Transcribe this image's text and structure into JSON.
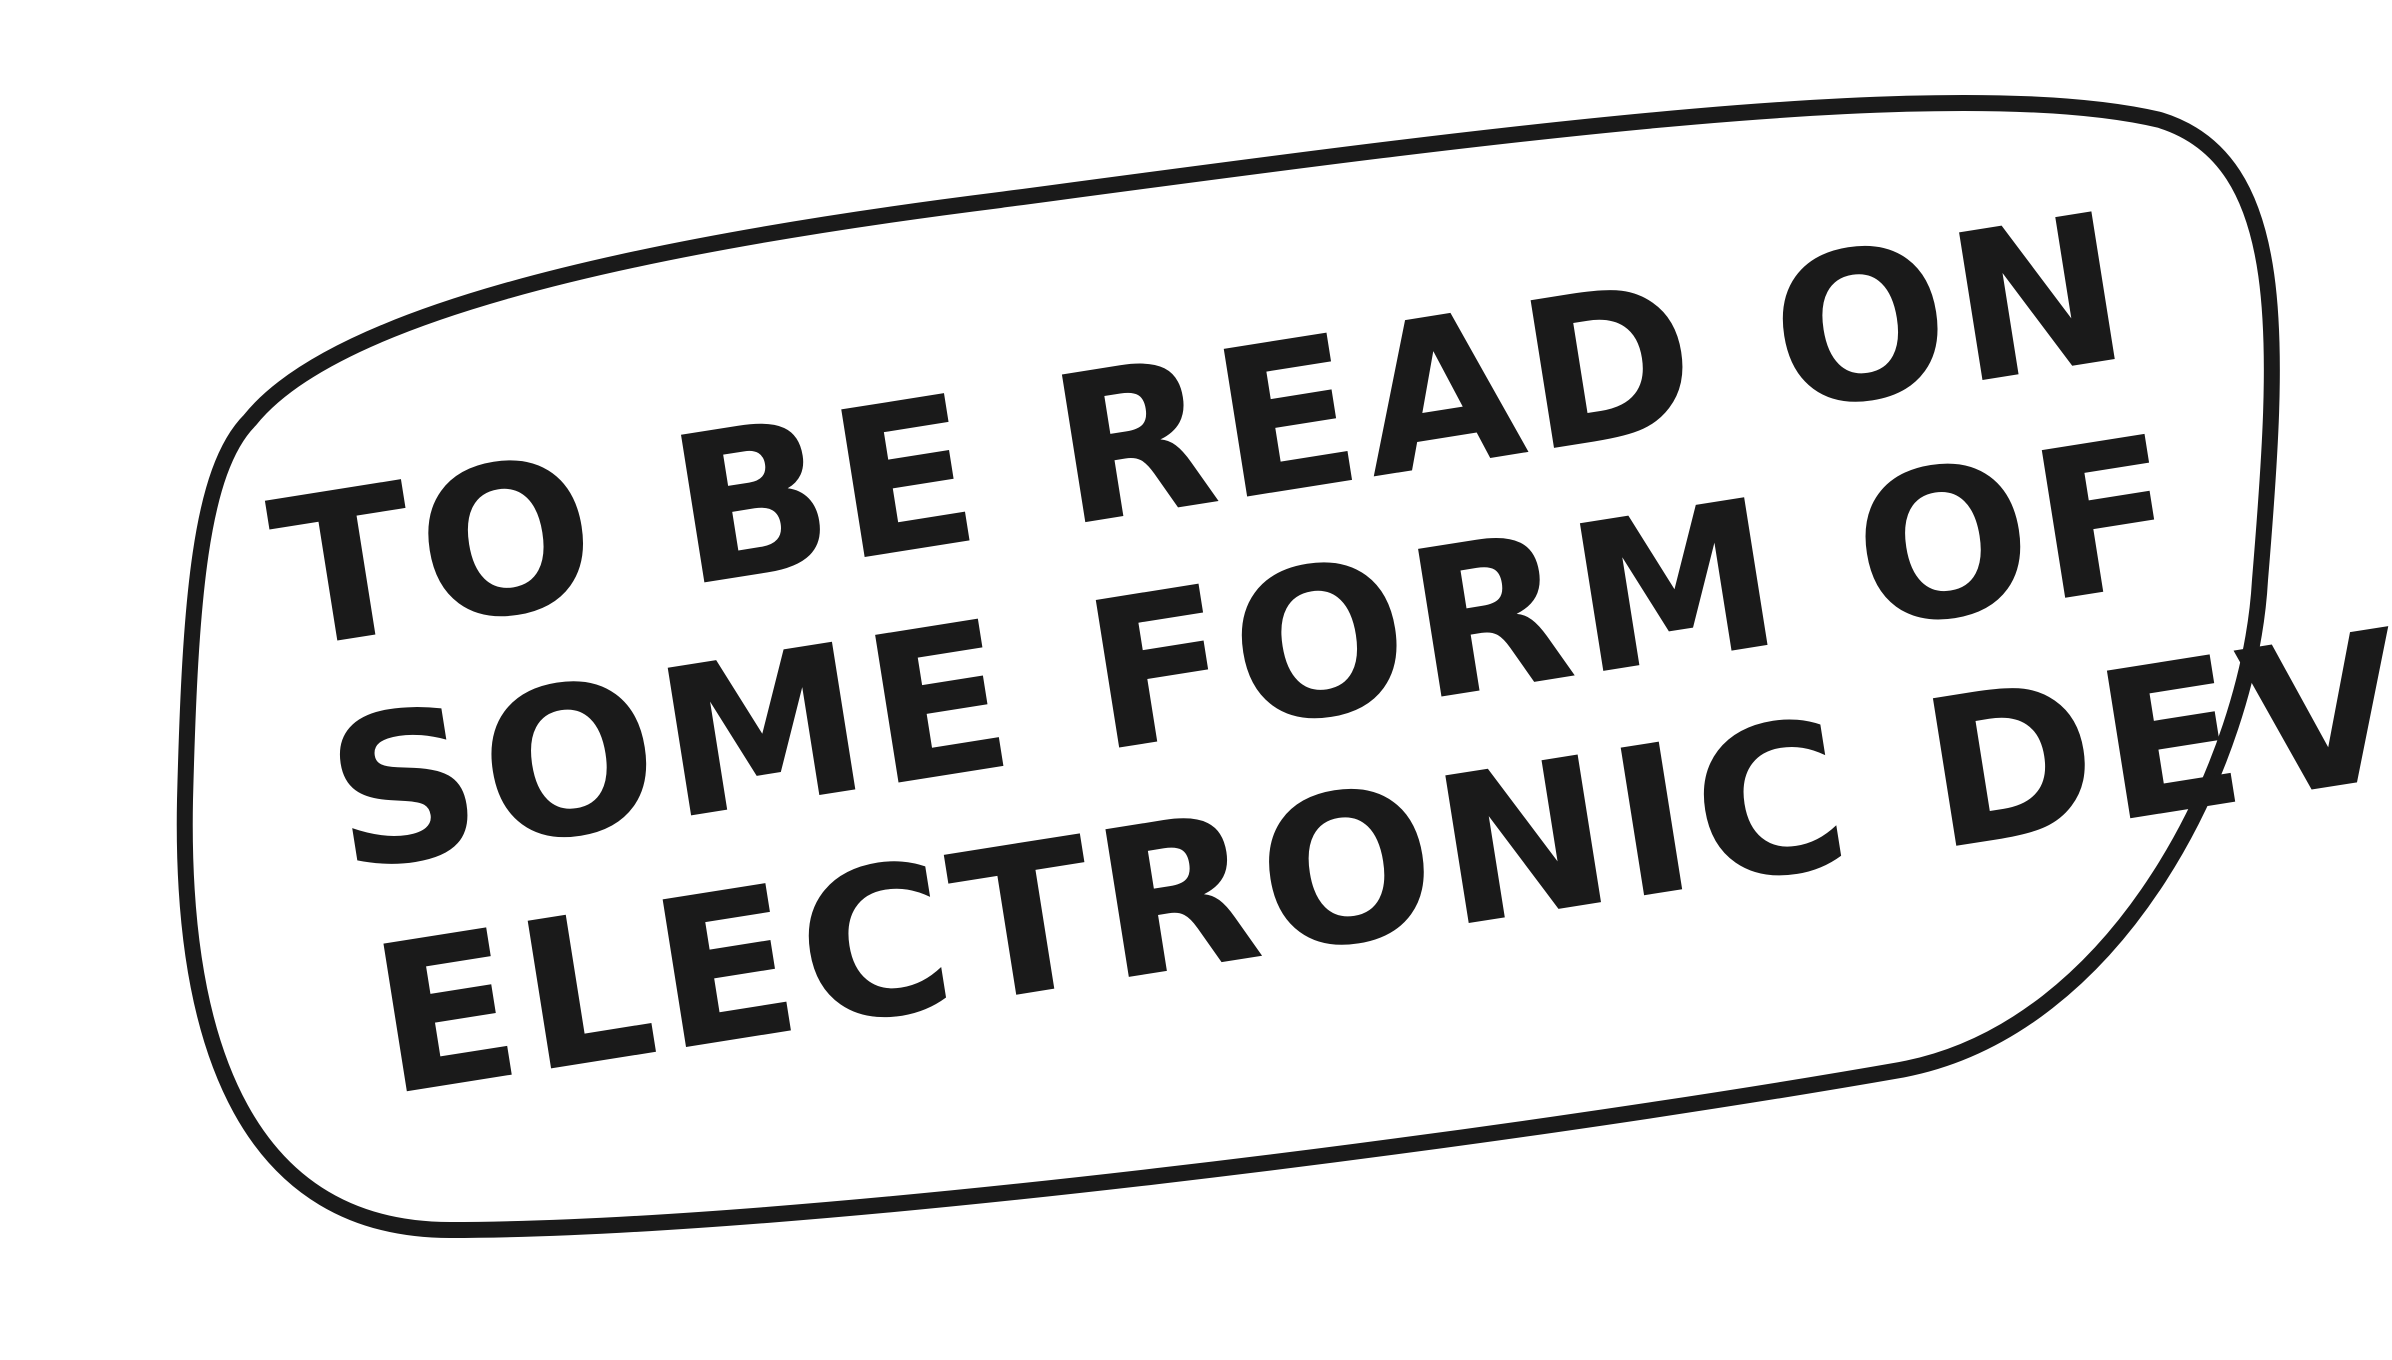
{
  "note": {
    "lines": [
      "TO BE READ ON",
      "SOME FORM OF",
      "ELECTRONIC DEVICE."
    ]
  },
  "colors": {
    "ink": "#1a1a1a",
    "paper": "#ffffff"
  }
}
